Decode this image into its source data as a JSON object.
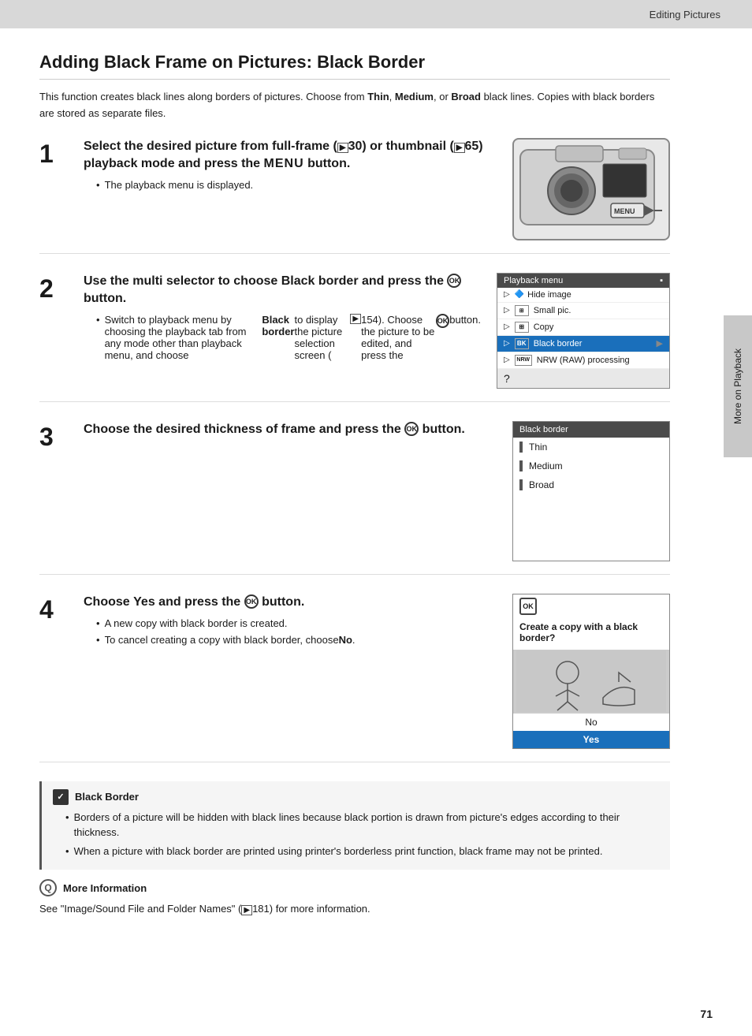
{
  "topBar": {
    "title": "Editing Pictures"
  },
  "pageTitle": "Adding Black Frame on Pictures: Black Border",
  "introText": "This function creates black lines along borders of pictures. Choose from ",
  "introThin": "Thin",
  "introMiddle": ", ",
  "introMedium": "Medium",
  "introOr": ", or ",
  "introBroad": "Broad",
  "introEnd": " black lines. Copies with black borders are stored as separate files.",
  "steps": [
    {
      "number": "1",
      "title": "Select the desired picture from full-frame (🔢30) or thumbnail (🔢65) playback mode and press the MENU button.",
      "titleParts": {
        "before": "Select the desired picture from full-frame (",
        "icon1": "▶",
        "ref1": "30",
        "middle": ") or thumbnail (",
        "icon2": "▶",
        "ref2": "65",
        "after": ") playback mode and press the ",
        "menuText": "MENU",
        "end": " button."
      },
      "bullet": "The playback menu is displayed.",
      "image": "camera"
    },
    {
      "number": "2",
      "title": "Use the multi selector to choose Black border and press the OK button.",
      "titleParts": {
        "before": "Use the multi selector to choose ",
        "bold": "Black border",
        "after": " and press the ",
        "ok": "OK",
        "end": " button."
      },
      "bulletLines": [
        "Switch to playback menu by choosing the playback tab from any mode other than playback menu, and choose ",
        "Black border",
        " to display the picture selection screen (",
        "▶154",
        "). Choose the picture to be edited, and press the ",
        "OK",
        " button."
      ],
      "image": "playbackMenu"
    },
    {
      "number": "3",
      "title": "Choose the desired thickness of frame and press the OK button.",
      "titleParts": {
        "before": "Choose the desired thickness of frame and press the ",
        "ok": "OK",
        "end": " button."
      },
      "image": "blackBorderMenu",
      "menuItems": [
        "Thin",
        "Medium",
        "Broad"
      ]
    },
    {
      "number": "4",
      "title": "Choose Yes and press the OK button.",
      "titleParts": {
        "before": "Choose ",
        "bold": "Yes",
        "after": " and press the ",
        "ok": "OK",
        "end": " button."
      },
      "bullets": [
        "A new copy with black border is created.",
        "To cancel creating a copy with black border, choose "
      ],
      "noText": "No",
      "image": "copyDialog"
    }
  ],
  "blackBorderNote": {
    "title": "Black Border",
    "bullets": [
      "Borders of a picture will be hidden with black lines because black portion is drawn from picture's edges according to their thickness.",
      "When a picture with black border are printed using printer's borderless print function, black frame may not be printed."
    ]
  },
  "moreInfo": {
    "title": "More Information",
    "text": "See \"Image/Sound File and Folder Names\" (",
    "ref": "▶181",
    "textEnd": ") for more information."
  },
  "sidebar": {
    "label": "More on Playback"
  },
  "pageNumber": "71",
  "playbackMenu": {
    "header": "Playback menu",
    "items": [
      {
        "icon": "🔷",
        "label": "Hide image"
      },
      {
        "icon": "▣",
        "label": "Small pic."
      },
      {
        "icon": "⊞",
        "label": "Copy"
      },
      {
        "icon": "BK",
        "label": "Black border",
        "selected": true,
        "hasArrow": true
      },
      {
        "icon": "NRW",
        "label": "NRW (RAW) processing"
      }
    ]
  },
  "blackBorderMenu": {
    "header": "Black border",
    "items": [
      "Thin",
      "Medium",
      "Broad"
    ]
  },
  "copyDialog": {
    "text": "Create a copy with a black border?",
    "no": "No",
    "yes": "Yes"
  }
}
